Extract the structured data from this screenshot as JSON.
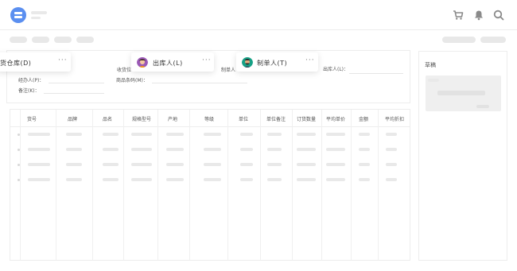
{
  "app": {
    "brand_color": "#5b8ff0"
  },
  "header": {
    "icons": [
      "cart-icon",
      "bell-icon",
      "search-icon"
    ],
    "icon_color": "#8a8a8a"
  },
  "form": {
    "fields": {
      "warehouse": "货仓库(D)",
      "receiver": "收货位",
      "maker": "制单人",
      "issuer": "出库人(L)：",
      "handler": "经办人(P)：",
      "barcode": "商品条码(M)：",
      "remark": "备注(K)："
    },
    "chips": [
      {
        "label": "出库人(L)",
        "dots": "···"
      },
      {
        "label": "制单人(T)",
        "dots": "···"
      }
    ],
    "warehouse_dots": "···"
  },
  "table": {
    "columns": [
      "货号",
      "品牌",
      "品名",
      "规格型号",
      "产地",
      "等级",
      "单位",
      "单位备注",
      "订货数量",
      "平均单价",
      "金额",
      "平均折扣"
    ],
    "row_count": 4
  },
  "panel": {
    "title": "草稿"
  }
}
